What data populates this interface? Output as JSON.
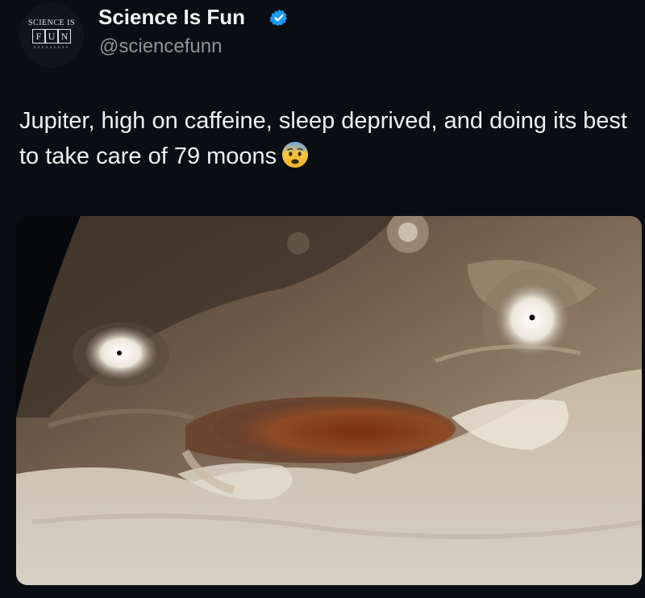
{
  "account": {
    "display_name": "Science Is Fun",
    "handle": "@sciencefunn",
    "avatar": {
      "top_text": "SCIENCE IS",
      "letters": [
        "F",
        "U",
        "N"
      ]
    },
    "verified_icon": "verified-badge-icon"
  },
  "tweet": {
    "text": "Jupiter, high on caffeine, sleep deprived, and doing its best to take care of 79 moons",
    "emoji": "anxious-face-with-sweat"
  },
  "colors": {
    "background": "#0a0e14",
    "verified_blue": "#1d9bf0",
    "handle_gray": "#8b949c"
  }
}
